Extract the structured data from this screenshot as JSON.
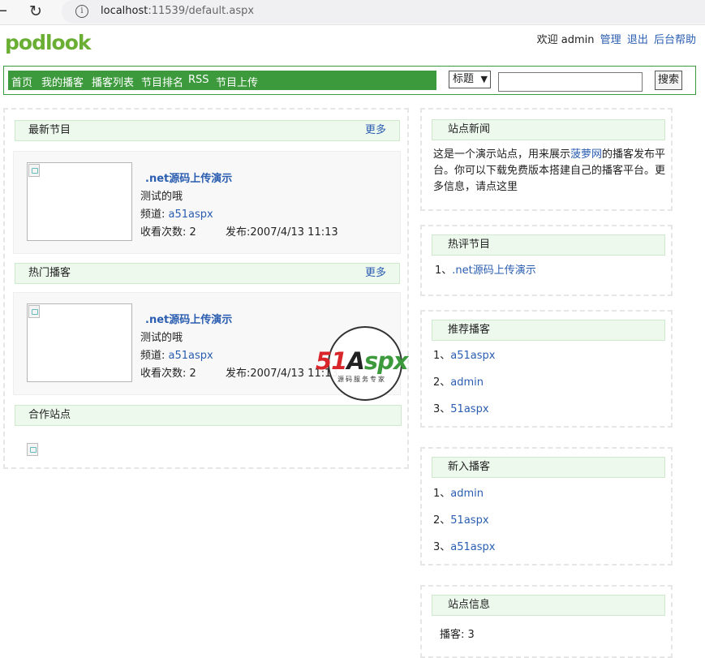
{
  "browser": {
    "url_host": "localhost",
    "url_rest": ":11539/default.aspx"
  },
  "logo": {
    "text": "podlook"
  },
  "toplinks": {
    "welcome": "欢迎 admin",
    "manage": "管理",
    "logout": "退出",
    "help": "后台帮助"
  },
  "nav": {
    "items": [
      "首页",
      "我的播客",
      "播客列表",
      "节目排名",
      "RSS",
      "节目上传"
    ]
  },
  "search": {
    "select_value": "标题",
    "input_value": "",
    "button": "搜索"
  },
  "latest": {
    "title": "最新节目",
    "more": "更多",
    "item": {
      "title": ".net源码上传演示",
      "desc": "测试的哦",
      "channel_label": "频道:",
      "channel": "a51aspx",
      "views": "收看次数: 2",
      "published": "发布:2007/4/13 11:13"
    }
  },
  "hot": {
    "title": "热门播客",
    "more": "更多",
    "item": {
      "title": ".net源码上传演示",
      "desc": "测试的哦",
      "channel_label": "频道:",
      "channel": "a51aspx",
      "views": "收看次数: 2",
      "published": "发布:2007/4/13 11:13"
    }
  },
  "partners": {
    "title": "合作站点"
  },
  "news": {
    "title": "站点新闻",
    "text_before": "这是一个演示站点，用来展示",
    "link": "菠萝网",
    "text_after": "的播客发布平台。你可以下载免费版本搭建自己的播客平台。更多信息，请点这里"
  },
  "hotcomment": {
    "title": "热评节目",
    "items": [
      {
        "num": "1、",
        "label": ".net源码上传演示"
      }
    ]
  },
  "recommend": {
    "title": "推荐播客",
    "items": [
      {
        "num": "1、",
        "label": "a51aspx"
      },
      {
        "num": "2、",
        "label": "admin"
      },
      {
        "num": "3、",
        "label": "51aspx"
      }
    ]
  },
  "newpod": {
    "title": "新入播客",
    "items": [
      {
        "num": "1、",
        "label": "admin"
      },
      {
        "num": "2、",
        "label": "51aspx"
      },
      {
        "num": "3、",
        "label": "a51aspx"
      }
    ]
  },
  "siteinfo": {
    "title": "站点信息",
    "podcasts_label": "播客:",
    "podcasts_value": "3"
  },
  "watermark": {
    "brand_51": "51",
    "brand_a": "A",
    "brand_spx": "spx",
    "sub": "源码服务专家"
  }
}
